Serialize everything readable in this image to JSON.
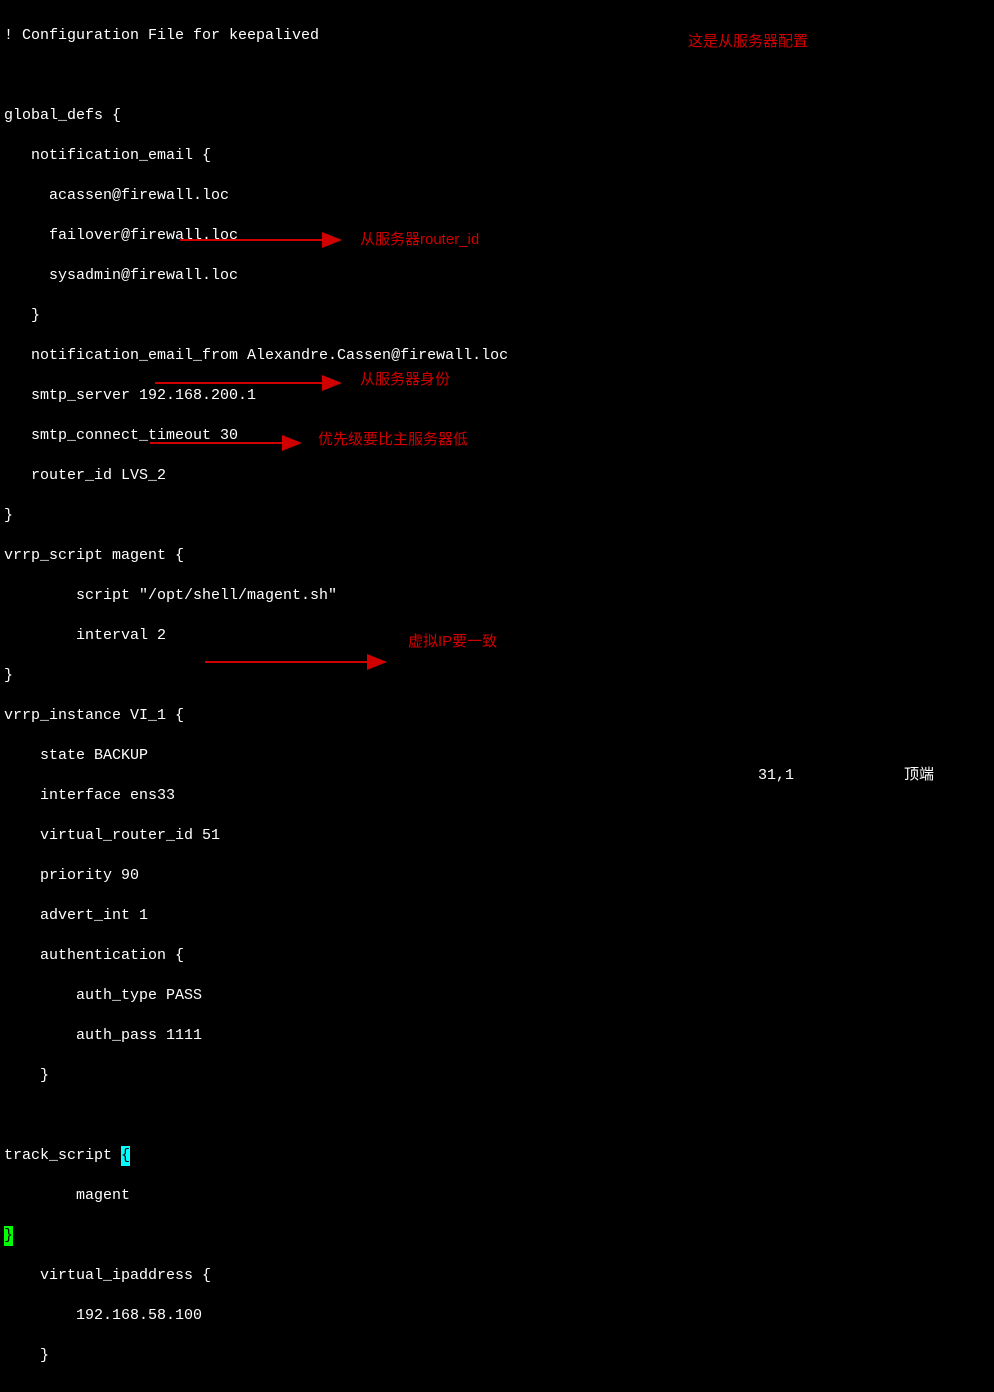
{
  "config": {
    "line1": "! Configuration File for keepalived",
    "line2": "",
    "line3": "global_defs {",
    "line4": "   notification_email {",
    "line5": "     acassen@firewall.loc",
    "line6": "     failover@firewall.loc",
    "line7": "     sysadmin@firewall.loc",
    "line8": "   }",
    "line9": "   notification_email_from Alexandre.Cassen@firewall.loc",
    "line10": "   smtp_server 192.168.200.1",
    "line11": "   smtp_connect_timeout 30",
    "line12pre": "   router_id LVS_2",
    "line13": "}",
    "line14": "vrrp_script magent {",
    "line15": "        script \"/opt/shell/magent.sh\"",
    "line16": "        interval 2",
    "line17": "}",
    "line18": "vrrp_instance VI_1 {",
    "line19": "    state BACKUP",
    "line20": "    interface ens33",
    "line21": "    virtual_router_id 51",
    "line22": "    priority 90",
    "line23": "    advert_int 1",
    "line24": "    authentication {",
    "line25": "        auth_type PASS",
    "line26": "        auth_pass 1111",
    "line27": "    }",
    "line28": "",
    "line29pre": "track_script ",
    "cursor": "{",
    "line30": "        magent",
    "greenBracket": "}",
    "line32": "    virtual_ipaddress {",
    "line33": "        192.168.58.100",
    "line34": "    }"
  },
  "annotations": {
    "topRight": "这是从服务器配置",
    "routerId": "从服务器router_id",
    "state": "从服务器身份",
    "priority": "优先级要比主服务器低",
    "vip": "虚拟IP要一致"
  },
  "status": {
    "pos": "31,1",
    "right": "顶端"
  }
}
